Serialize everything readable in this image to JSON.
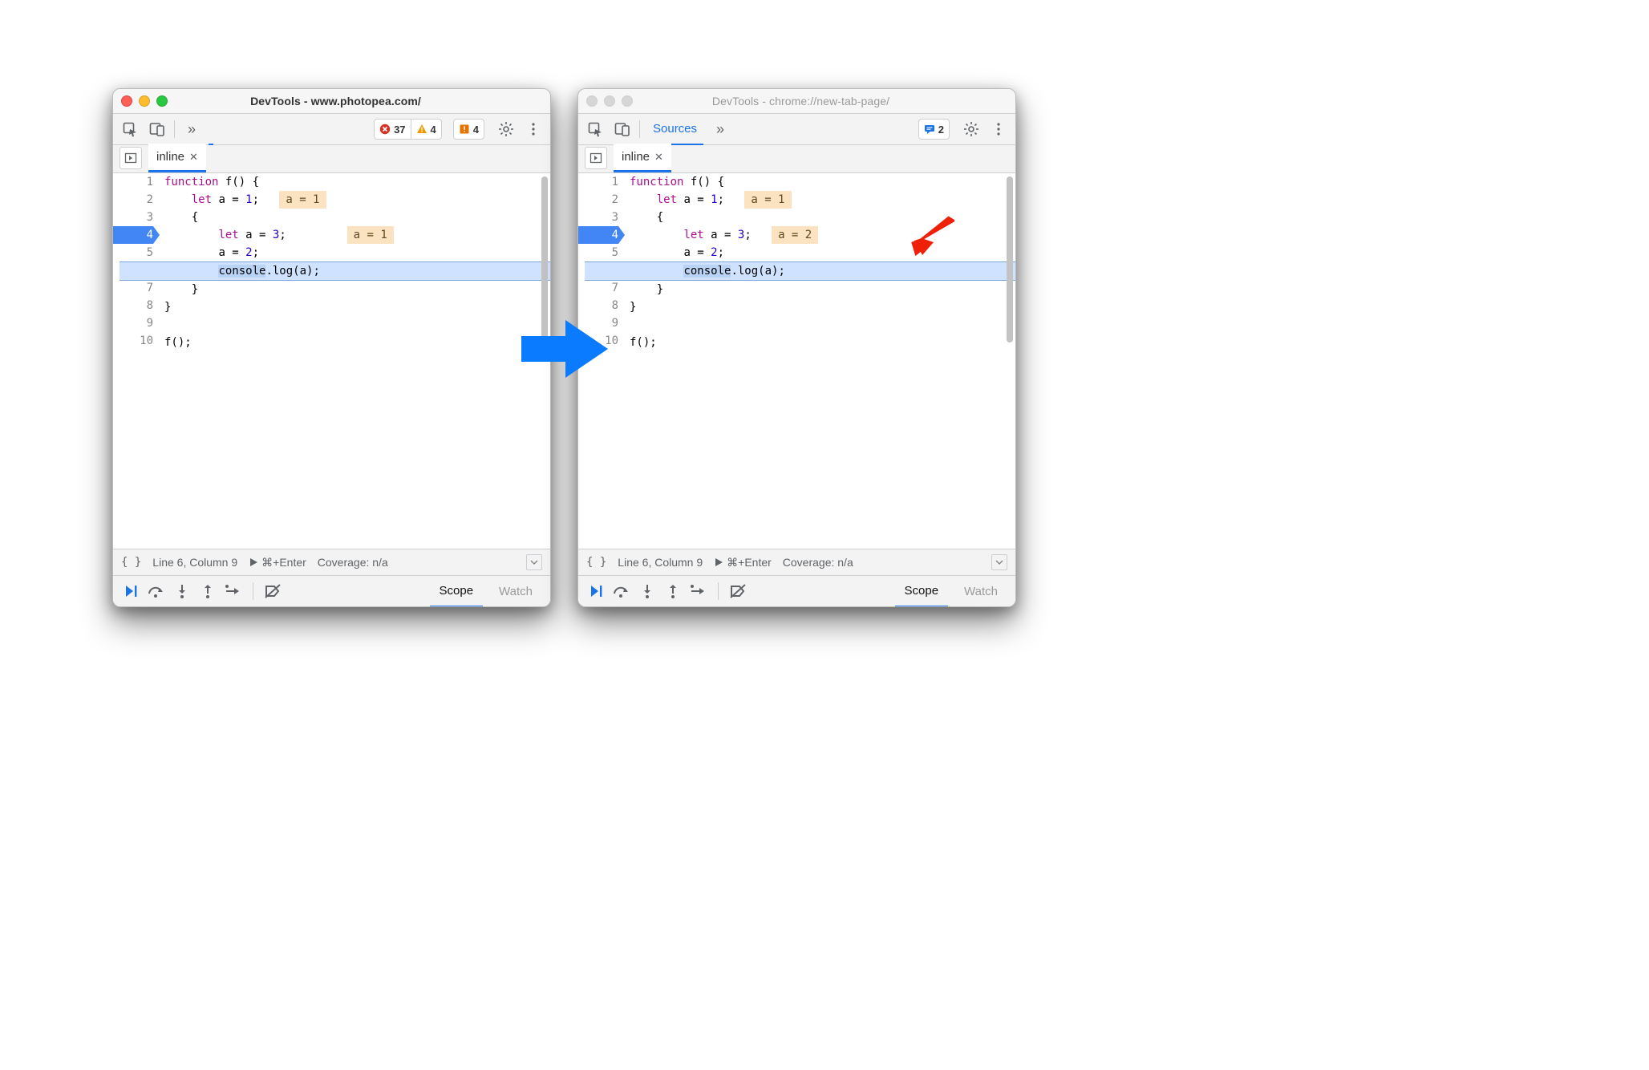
{
  "left": {
    "title": "DevTools - www.photopea.com/",
    "active": true,
    "toolbar": {
      "errors": "37",
      "warnings_a": "4",
      "warnings_b": "4",
      "show_sources_tab": false,
      "sources_label": "Sources"
    },
    "file_tab": "inline",
    "lines": [
      {
        "n": "1",
        "bp": false,
        "exec": false,
        "pre": "",
        "tokens": [
          {
            "t": "function",
            "c": "kw"
          },
          {
            "t": " f() {"
          }
        ],
        "hint": null
      },
      {
        "n": "2",
        "bp": false,
        "exec": false,
        "pre": "    ",
        "tokens": [
          {
            "t": "let",
            "c": "kw"
          },
          {
            "t": " a = "
          },
          {
            "t": "1",
            "c": "num"
          },
          {
            "t": ";"
          }
        ],
        "hint": "a = 1"
      },
      {
        "n": "3",
        "bp": false,
        "exec": false,
        "pre": "    ",
        "tokens": [
          {
            "t": "{"
          }
        ],
        "hint": null
      },
      {
        "n": "4",
        "bp": true,
        "exec": false,
        "pre": "        ",
        "tokens": [
          {
            "t": "let",
            "c": "kw"
          },
          {
            "t": " a = "
          },
          {
            "t": "3",
            "c": "num"
          },
          {
            "t": ";"
          }
        ],
        "hint": "a = 1",
        "hint_far": true
      },
      {
        "n": "5",
        "bp": false,
        "exec": false,
        "pre": "        ",
        "tokens": [
          {
            "t": "a = "
          },
          {
            "t": "2",
            "c": "num"
          },
          {
            "t": ";"
          }
        ],
        "hint": null
      },
      {
        "n": "6",
        "bp": false,
        "exec": true,
        "pre": "        ",
        "tokens": [
          {
            "t": "console",
            "c": "sel"
          },
          {
            "t": ".log(a);"
          }
        ],
        "hint": null
      },
      {
        "n": "7",
        "bp": false,
        "exec": false,
        "pre": "    ",
        "tokens": [
          {
            "t": "}"
          }
        ],
        "hint": null
      },
      {
        "n": "8",
        "bp": false,
        "exec": false,
        "pre": "",
        "tokens": [
          {
            "t": "}"
          }
        ],
        "hint": null
      },
      {
        "n": "9",
        "bp": false,
        "exec": false,
        "pre": "",
        "tokens": [],
        "hint": null
      },
      {
        "n": "10",
        "bp": false,
        "exec": false,
        "pre": "",
        "tokens": [
          {
            "t": "f();"
          }
        ],
        "hint": null
      }
    ],
    "status": {
      "pos": "Line 6, Column 9",
      "run": "⌘+Enter",
      "coverage": "Coverage: n/a"
    },
    "dbg_tabs": {
      "scope": "Scope",
      "watch": "Watch"
    }
  },
  "right": {
    "title": "DevTools - chrome://new-tab-page/",
    "active": false,
    "toolbar": {
      "issues": "2",
      "show_sources_tab": true,
      "sources_label": "Sources"
    },
    "file_tab": "inline",
    "lines": [
      {
        "n": "1",
        "bp": false,
        "exec": false,
        "pre": "",
        "tokens": [
          {
            "t": "function",
            "c": "kw"
          },
          {
            "t": " f() {"
          }
        ],
        "hint": null
      },
      {
        "n": "2",
        "bp": false,
        "exec": false,
        "pre": "    ",
        "tokens": [
          {
            "t": "let",
            "c": "kw"
          },
          {
            "t": " a = "
          },
          {
            "t": "1",
            "c": "num"
          },
          {
            "t": ";"
          }
        ],
        "hint": "a = 1"
      },
      {
        "n": "3",
        "bp": false,
        "exec": false,
        "pre": "    ",
        "tokens": [
          {
            "t": "{"
          }
        ],
        "hint": null
      },
      {
        "n": "4",
        "bp": true,
        "exec": false,
        "pre": "        ",
        "tokens": [
          {
            "t": "let",
            "c": "kw"
          },
          {
            "t": " a = "
          },
          {
            "t": "3",
            "c": "num"
          },
          {
            "t": ";"
          }
        ],
        "hint": "a = 2",
        "arrow": true
      },
      {
        "n": "5",
        "bp": false,
        "exec": false,
        "pre": "        ",
        "tokens": [
          {
            "t": "a = "
          },
          {
            "t": "2",
            "c": "num"
          },
          {
            "t": ";"
          }
        ],
        "hint": null
      },
      {
        "n": "6",
        "bp": false,
        "exec": true,
        "pre": "        ",
        "tokens": [
          {
            "t": "console",
            "c": "sel"
          },
          {
            "t": ".log(a);"
          }
        ],
        "hint": null
      },
      {
        "n": "7",
        "bp": false,
        "exec": false,
        "pre": "    ",
        "tokens": [
          {
            "t": "}"
          }
        ],
        "hint": null
      },
      {
        "n": "8",
        "bp": false,
        "exec": false,
        "pre": "",
        "tokens": [
          {
            "t": "}"
          }
        ],
        "hint": null
      },
      {
        "n": "9",
        "bp": false,
        "exec": false,
        "pre": "",
        "tokens": [],
        "hint": null
      },
      {
        "n": "10",
        "bp": false,
        "exec": false,
        "pre": "",
        "tokens": [
          {
            "t": "f();"
          }
        ],
        "hint": null
      }
    ],
    "status": {
      "pos": "Line 6, Column 9",
      "run": "⌘+Enter",
      "coverage": "Coverage: n/a"
    },
    "dbg_tabs": {
      "scope": "Scope",
      "watch": "Watch"
    }
  }
}
